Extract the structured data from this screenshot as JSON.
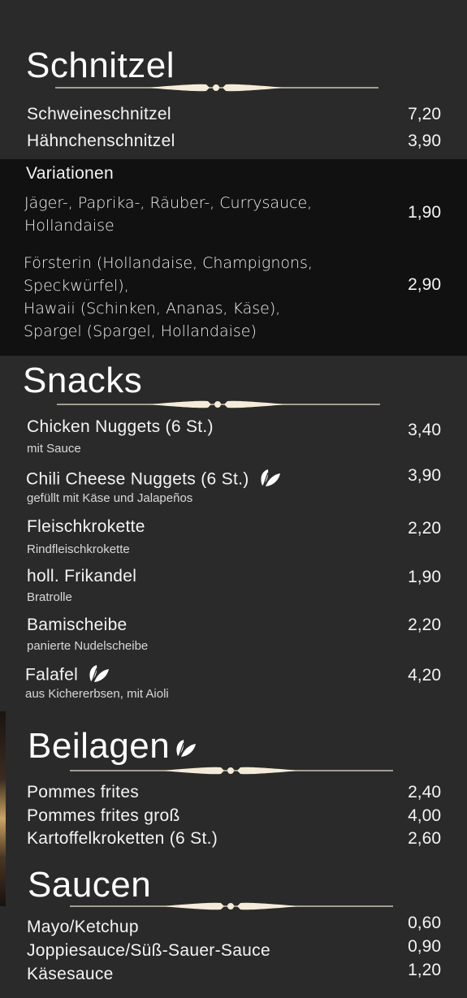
{
  "colors": {
    "background": "#2a2a2a",
    "band": "#111111",
    "text": "#f4f4f4",
    "ornament": "#f4ecd8"
  },
  "schnitzel": {
    "title": "Schnitzel",
    "items": [
      {
        "name": "Schweineschnitzel",
        "price": "7,20"
      },
      {
        "name": "Hähnchenschnitzel",
        "price": "3,90"
      }
    ],
    "variations": {
      "heading": "Variationen",
      "options": [
        {
          "lines": [
            "Jäger-, Paprika-, Räuber-, Currysauce,",
            "Hollandaise"
          ],
          "price": "1,90"
        },
        {
          "lines": [
            "Försterin (Hollandaise, Champignons,",
            "Speckwürfel),",
            "Hawaii (Schinken, Ananas, Käse),",
            "Spargel (Spargel, Hollandaise)"
          ],
          "price": "2,90"
        }
      ]
    }
  },
  "snacks": {
    "title": "Snacks",
    "items": [
      {
        "name": "Chicken Nuggets (6 St.)",
        "sub": "mit Sauce",
        "price": "3,40",
        "veggie": false
      },
      {
        "name": "Chili Cheese Nuggets (6 St.)",
        "sub": "gefüllt mit Käse und Jalapeños",
        "price": "3,90",
        "veggie": true
      },
      {
        "name": "Fleischkrokette",
        "sub": "Rindfleischkrokette",
        "price": "2,20",
        "veggie": false
      },
      {
        "name": "holl. Frikandel",
        "sub": "Bratrolle",
        "price": "1,90",
        "veggie": false
      },
      {
        "name": "Bamischeibe",
        "sub": "panierte Nudelscheibe",
        "price": "2,20",
        "veggie": false
      },
      {
        "name": "Falafel",
        "sub": "aus Kichererbsen, mit Aioli",
        "price": "4,20",
        "veggie": true
      }
    ]
  },
  "beilagen": {
    "title": "Beilagen",
    "icon": "leaf-icon",
    "items": [
      {
        "name": "Pommes frites",
        "price": "2,40"
      },
      {
        "name": "Pommes frites groß",
        "price": "4,00"
      },
      {
        "name": "Kartoffelkroketten (6 St.)",
        "price": "2,60"
      }
    ]
  },
  "saucen": {
    "title": "Saucen",
    "items": [
      {
        "name": "Mayo/Ketchup",
        "price": "0,60"
      },
      {
        "name": "Joppiesauce/Süß-Sauer-Sauce",
        "price": "0,90"
      },
      {
        "name": "Käsesauce",
        "price": "1,20"
      }
    ]
  }
}
